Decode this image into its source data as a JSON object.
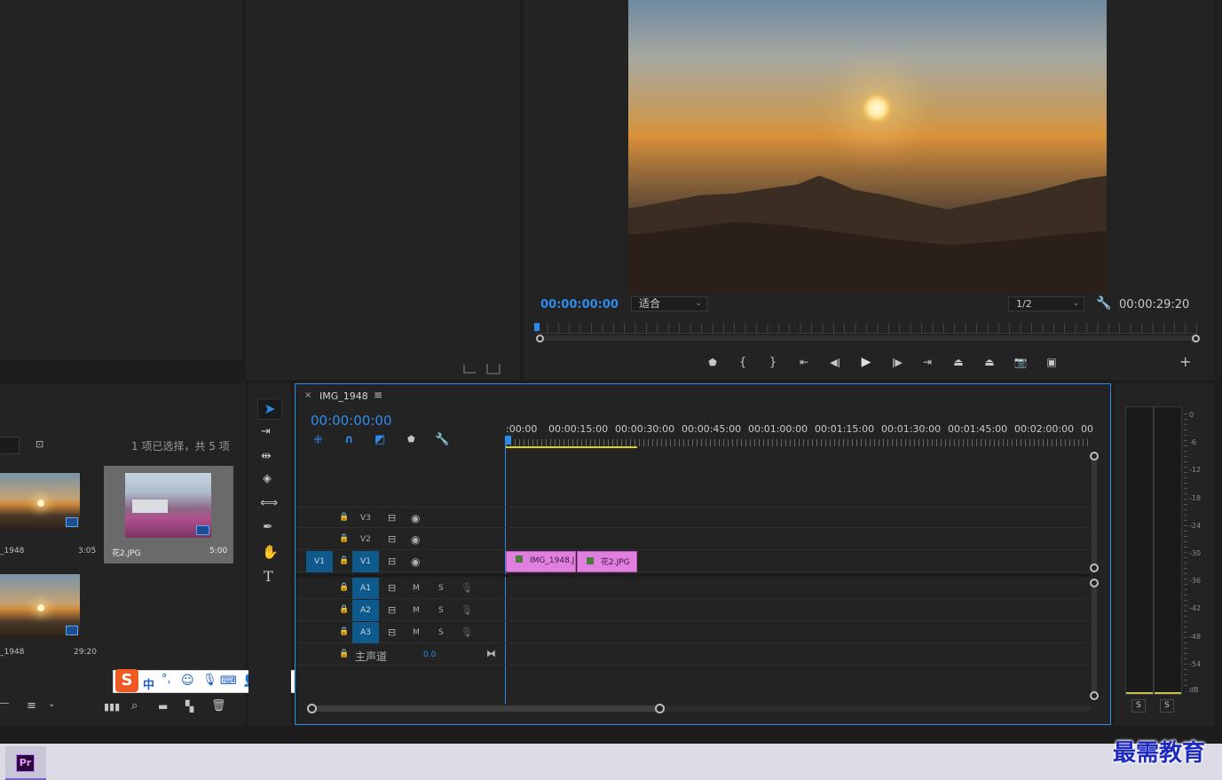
{
  "program_monitor": {
    "timecode_current": "00:00:00:00",
    "fit_select": "适合",
    "resolution_select": "1/2",
    "timecode_duration": "00:00:29:20"
  },
  "project_panel": {
    "selection_status": "1 项已选择，共 5 项",
    "items": [
      {
        "name": "_1948",
        "duration": "3:05"
      },
      {
        "name": "花2.JPG",
        "duration": "5:00"
      },
      {
        "name": "_1948",
        "duration": "29:20"
      }
    ]
  },
  "timeline": {
    "tab_title": "IMG_1948",
    "timecode": "00:00:00:00",
    "ruler": [
      ":00:00",
      "00:00:15:00",
      "00:00:30:00",
      "00:00:45:00",
      "00:01:00:00",
      "00:01:15:00",
      "00:01:30:00",
      "00:01:45:00",
      "00:02:00:00",
      "00"
    ],
    "video_tracks": [
      "V3",
      "V2",
      "V1"
    ],
    "source_patch": "V1",
    "audio_tracks": [
      "A1",
      "A2",
      "A3"
    ],
    "mute_label": "M",
    "solo_label": "S",
    "master_label": "主声道",
    "master_value": "0.0",
    "clips": [
      {
        "name": "IMG_1948.J"
      },
      {
        "name": "花2.JPG"
      }
    ]
  },
  "audio_meter": {
    "scale": [
      "0",
      "-6",
      "-12",
      "-18",
      "-24",
      "-30",
      "-36",
      "-42",
      "-48",
      "-54",
      "dB"
    ],
    "solo_left": "S",
    "solo_right": "S"
  },
  "ime_toolbar": {
    "logo": "S",
    "lang": "中"
  },
  "taskbar": {
    "premiere_icon": "Pr"
  },
  "watermark": "最需教育",
  "colors": {
    "accent_blue": "#2d8ceb",
    "clip_pink": "#e07fe0",
    "track_chip": "#0e5a8c"
  }
}
